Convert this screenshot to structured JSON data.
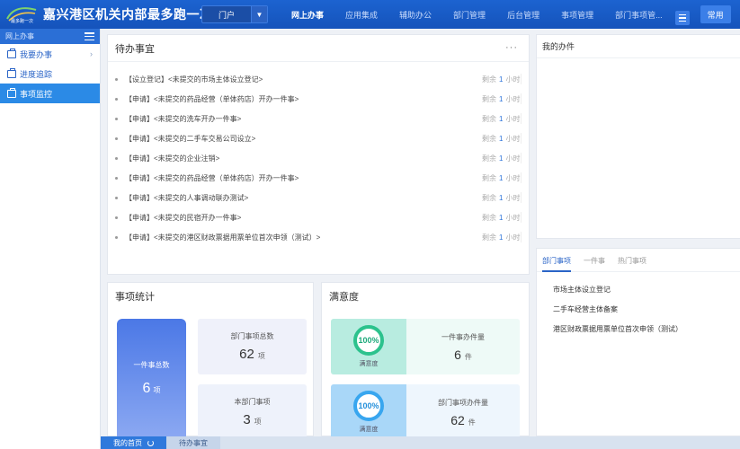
{
  "header": {
    "logo_text": "最多跑一次",
    "title": "嘉兴港区机关内部最多跑一次",
    "portal_value": "门户",
    "nav": [
      "网上办事",
      "应用集成",
      "辅助办公",
      "部门管理",
      "后台管理",
      "事项管理",
      "部门事项管..."
    ],
    "active_nav": "网上办事",
    "common_label": "常用"
  },
  "sidebar": {
    "title": "网上办事",
    "items": [
      {
        "label": "我要办事",
        "icon": "folder-icon",
        "has_children": true
      },
      {
        "label": "进度追踪",
        "icon": "folder-icon",
        "has_children": false
      },
      {
        "label": "事项监控",
        "icon": "folder-icon",
        "has_children": false,
        "active": true
      }
    ]
  },
  "todo": {
    "title": "待办事宜",
    "more": "···",
    "items": [
      {
        "text": "【设立登记】<未提交的市场主体设立登记>",
        "remain_prefix": "剩余",
        "remain_value": "1",
        "remain_unit": "小时"
      },
      {
        "text": "【申请】<未提交的药品经营（单体药店）开办一件事>",
        "remain_prefix": "剩余",
        "remain_value": "1",
        "remain_unit": "小时"
      },
      {
        "text": "【申请】<未提交的洗车开办一件事>",
        "remain_prefix": "剩余",
        "remain_value": "1",
        "remain_unit": "小时"
      },
      {
        "text": "【申请】<未提交的二手车交易公司设立>",
        "remain_prefix": "剩余",
        "remain_value": "1",
        "remain_unit": "小时"
      },
      {
        "text": "【申请】<未提交的企业注销>",
        "remain_prefix": "剩余",
        "remain_value": "1",
        "remain_unit": "小时"
      },
      {
        "text": "【申请】<未提交的药品经营（单体药店）开办一件事>",
        "remain_prefix": "剩余",
        "remain_value": "1",
        "remain_unit": "小时"
      },
      {
        "text": "【申请】<未提交的人事调动联办测试>",
        "remain_prefix": "剩余",
        "remain_value": "1",
        "remain_unit": "小时"
      },
      {
        "text": "【申请】<未提交的民宿开办一件事>",
        "remain_prefix": "剩余",
        "remain_value": "1",
        "remain_unit": "小时"
      },
      {
        "text": "【申请】<未提交的港区财政票据用票单位首次申领（测试）>",
        "remain_prefix": "剩余",
        "remain_value": "1",
        "remain_unit": "小时"
      }
    ]
  },
  "mywork": {
    "title": "我的办件"
  },
  "dept": {
    "tabs": [
      "部门事项",
      "一件事",
      "热门事项"
    ],
    "active_tab": "部门事项",
    "items": [
      "市场主体设立登记",
      "二手车经营主体备案",
      "港区财政票据用票单位首次申领（测试）"
    ]
  },
  "stats": {
    "title": "事项统计",
    "total_label": "一件事总数",
    "total_value": "6",
    "total_unit": "项",
    "dept_total_label": "部门事项总数",
    "dept_total_value": "62",
    "dept_total_unit": "项",
    "own_label": "本部门事项",
    "own_value": "3",
    "own_unit": "项"
  },
  "satisfaction": {
    "title": "满意度",
    "rows": [
      {
        "percent_text": "100%",
        "caption": "满意度",
        "label": "一件事办件量",
        "value": "6",
        "unit": "件",
        "accent": "#2cc28d"
      },
      {
        "percent_text": "100%",
        "caption": "满意度",
        "label": "部门事项办件量",
        "value": "62",
        "unit": "件",
        "accent": "#38a6ef"
      }
    ]
  },
  "bottom_tabs": [
    {
      "label": "我的首页",
      "active": true
    },
    {
      "label": "待办事宜",
      "active": false
    }
  ],
  "colors": {
    "brand": "#1c63d0",
    "accent": "#2b8ae6"
  }
}
